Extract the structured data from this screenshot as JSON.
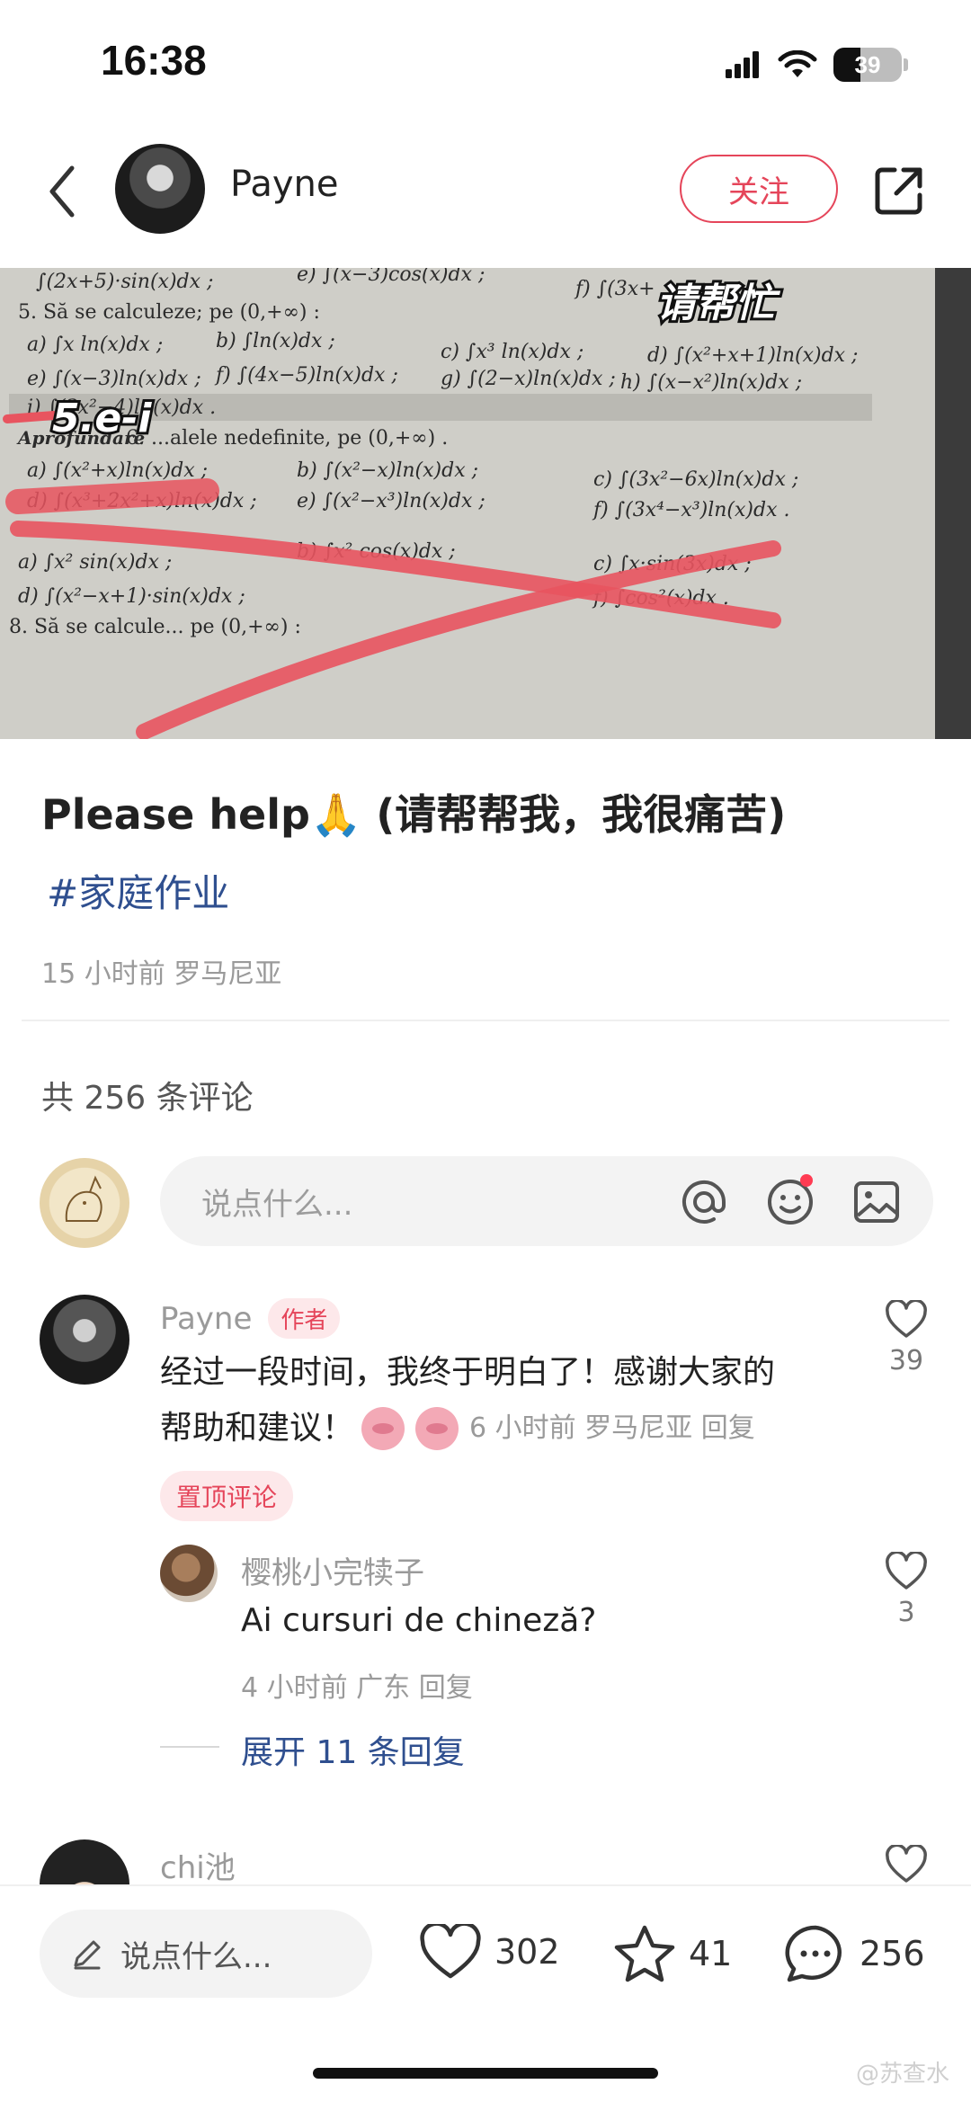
{
  "status_bar": {
    "time": "16:38",
    "battery": "39",
    "battery_level": 0.39
  },
  "header": {
    "author": "Payne",
    "follow_label": "关注"
  },
  "image": {
    "overlay_top": "请帮忙",
    "overlay_left": "5.e-i",
    "textbook_lines": [
      "∫(2x+5)·sin(x)dx ;",
      "e) ∫(x−3)cos(x)dx ;",
      "f) ∫(3x+",
      "5. Să se calculeze; pe (0,+∞) :",
      "a) ∫x ln(x)dx ;",
      "b) ∫ln(x)dx ;",
      "c) ∫x³ ln(x)dx ;",
      "d) ∫(x²+x+1)ln(x)dx ;",
      "e) ∫(x−3)ln(x)dx ;",
      "f) ∫(4x−5)ln(x)dx ;",
      "g) ∫(2−x)ln(x)dx ;",
      "h) ∫(x−x²)ln(x)dx ;",
      "i) ∫(3x²−4)ln(x)dx .",
      "Aprofundare",
      "6. ...alele nedefinite, pe (0,+∞) .",
      "a) ∫(x²+x)ln(x)dx ;",
      "b) ∫(x²−x)ln(x)dx ;",
      "c) ∫(3x²−6x)ln(x)dx ;",
      "d) ∫(x³+2x²+x)ln(x)dx ;",
      "e) ∫(x²−x³)ln(x)dx ;",
      "f) ∫(3x⁴−x³)ln(x)dx .",
      "a) ∫x² sin(x)dx ;",
      "b) ∫x² cos(x)dx ;",
      "c) ∫x·sin(3x)dx ;",
      "d) ∫(x²−x+1)·sin(x)dx ;",
      "f) ∫cos²(x)dx .",
      "8. Să se calcule... pe (0,+∞) :"
    ]
  },
  "post": {
    "title": "Please help🙏 (请帮帮我，我很痛苦)",
    "hashtag": "#家庭作业",
    "meta": "15 小时前 罗马尼亚"
  },
  "comments_header": "共 256 条评论",
  "comment_input": {
    "placeholder": "说点什么..."
  },
  "comments": [
    {
      "name": "Payne",
      "badge": "作者",
      "text_line1": "经过一段时间，我终于明白了！感谢大家的",
      "text_line2": "帮助和建议！",
      "meta": "6 小时前 罗马尼亚 回复",
      "likes": "39",
      "pinned": "置顶评论"
    }
  ],
  "reply": {
    "name": "樱桃小完犊子",
    "text": "Ai cursuri de chineză?",
    "meta": "4 小时前 广东 回复",
    "likes": "3"
  },
  "expand_replies": "展开 11 条回复",
  "next_comment": {
    "name": "chi池"
  },
  "bottom_bar": {
    "placeholder": "说点什么...",
    "likes": "302",
    "stars": "41",
    "comments": "256"
  },
  "watermark": "@苏查水",
  "colors": {
    "accent": "#e5455a",
    "link": "#2f4f8f",
    "scribble": "#e8545f"
  }
}
